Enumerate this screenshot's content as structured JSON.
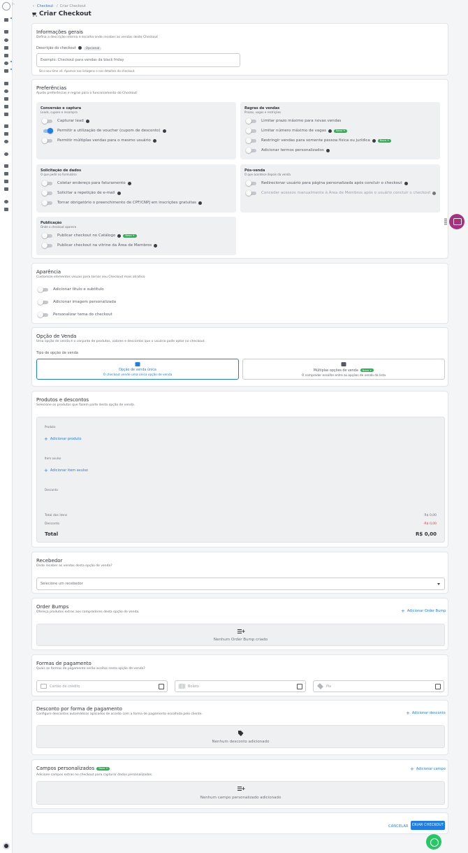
{
  "breadcrumb": {
    "parent": "Checkout",
    "separator": "/",
    "current": "Criar Checkout"
  },
  "page_title": "Criar Checkout",
  "general": {
    "title": "Informações gerais",
    "subtitle": "Defina a descrição interna e escolha onde receber as vendas deste Checkout",
    "description_label": "Descrição do checkout",
    "optional_badge": "Opcional",
    "description_placeholder": "Exemplo: Checkout para vendas da black friday",
    "description_hint": "Só o seu time vê. Aparece nas listagens e nos detalhes do checkout."
  },
  "preferences": {
    "title": "Preferências",
    "subtitle": "Ajuste preferências e regras para o funcionamento do Checkout",
    "conversion": {
      "title": "Conversão e captura",
      "subtitle": "Leads, cupons e recompra",
      "items": [
        {
          "label": "Capturar lead",
          "on": false
        },
        {
          "label": "Permitir a utilização de voucher (cupom de desconto)",
          "on": true
        },
        {
          "label": "Permitir múltiplas vendas para o mesmo usuário",
          "on": false
        }
      ]
    },
    "sales_rules": {
      "title": "Regras de vendas",
      "subtitle": "Prazos, vagas e restrições",
      "items": [
        {
          "label": "Limitar prazo máximo para novas vendas",
          "on": false
        },
        {
          "label": "Limitar número máximo de vagas",
          "on": false,
          "badge": "Novo"
        },
        {
          "label": "Restringir vendas para somente pessoa física ou jurídica",
          "on": false,
          "badge": "Novo"
        },
        {
          "label": "Adicionar termos personalizados",
          "on": false
        }
      ]
    },
    "data_request": {
      "title": "Solicitação de dados",
      "subtitle": "O que pedir no formulário",
      "items": [
        {
          "label": "Coletar endereço para faturamento",
          "on": false
        },
        {
          "label": "Solicitar a repetição de e-mail",
          "on": false
        },
        {
          "label": "Tornar obrigatório o preenchimento de CPF/CNPJ em inscrições gratuitas",
          "on": false
        }
      ]
    },
    "post_sale": {
      "title": "Pós-venda",
      "subtitle": "O que acontece depois da venda",
      "items": [
        {
          "label": "Redirecionar usuário para página personalizada após concluir o checkout",
          "on": false
        },
        {
          "label": "Conceder acessos manualmente à Área de Membros após o usuário concluir o checkout",
          "on": false,
          "disabled": true
        }
      ]
    },
    "publication": {
      "title": "Publicação",
      "subtitle": "Onde o checkout aparece",
      "items": [
        {
          "label": "Publicar checkout no Catálogo",
          "on": false,
          "badge": "Novo"
        },
        {
          "label": "Publicar checkout na vitrine da Área de Membros",
          "on": false
        }
      ]
    }
  },
  "appearance": {
    "title": "Aparência",
    "subtitle": "Customize elementos visuais para tornar seu Checkout mais atrativo",
    "items": [
      {
        "label": "Adicionar título e subtítulo"
      },
      {
        "label": "Adicionar imagem personalizada"
      },
      {
        "label": "Personalizar tema do checkout"
      }
    ]
  },
  "sale_option": {
    "title": "Opção de Venda",
    "subtitle": "Uma opção de venda é o conjunto de produtos, valores e descontos que o usuário pode optar no checkout.",
    "type_label": "Tipo de opção de venda",
    "single": {
      "title": "Opção de venda única",
      "desc": "O checkout vende uma única opção de venda"
    },
    "multiple": {
      "title": "Múltiplas opções de venda",
      "badge": "Novo",
      "desc": "O comprador escolhe entre as opções de venda da lista"
    }
  },
  "products": {
    "title": "Produtos e descontos",
    "subtitle": "Selecione os produtos que fazem parte desta opção de venda.",
    "product_label": "Produto",
    "add_product": "Adicionar produto",
    "addon_label": "Item avulso",
    "add_addon": "Adicionar item avulso",
    "discount_label": "Desconto",
    "items_total_label": "Total dos itens",
    "items_total_value": "R$ 0,00",
    "discount_row_label": "Desconto",
    "discount_value": "-R$ 0,00",
    "total_label": "Total",
    "total_value": "R$ 0,00"
  },
  "receiver": {
    "title": "Recebedor",
    "subtitle": "Onde receber as vendas desta opção de venda?",
    "placeholder": "Selecione um recebedor"
  },
  "order_bumps": {
    "title": "Order Bumps",
    "subtitle": "Ofereça produtos extras aos compradores desta opção de venda.",
    "add": "Adicionar Order Bump",
    "empty": "Nenhum Order Bump criado"
  },
  "payment": {
    "title": "Formas de pagamento",
    "subtitle": "Quais as formas de pagamento serão aceitas nesta opção de venda?",
    "methods": [
      "Cartão de crédito",
      "Boleto",
      "Pix"
    ]
  },
  "payment_discount": {
    "title": "Desconto por forma de pagamento",
    "subtitle": "Configure descontos automáticos aplicados de acordo com a forma de pagamento escolhida pelo cliente.",
    "add": "Adicionar desconto",
    "empty": "Nenhum desconto adicionado"
  },
  "custom_fields": {
    "title": "Campos personalizados",
    "badge": "Novo",
    "subtitle": "Adicione campos extras no checkout para capturar dados personalizados.",
    "add": "Adicionar campo",
    "empty": "Nenhum campo personalizado adicionado"
  },
  "actions": {
    "cancel": "CANCELAR",
    "create": "CRIAR CHECKOUT"
  },
  "colors": {
    "accent": "#1f7de6",
    "badge_new": "#2eb351",
    "chat_fab": "#a8317f",
    "whatsapp": "#25c865"
  }
}
